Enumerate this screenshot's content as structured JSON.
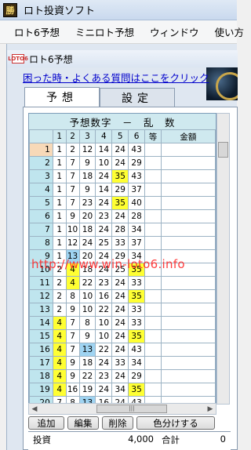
{
  "app": {
    "title": "ロト投資ソフト",
    "icon": "app-icon",
    "icon_glyph": "勝"
  },
  "menu": [
    "ロト6予想",
    "ミニロト予想",
    "ウィンドウ",
    "使い方"
  ],
  "child_window": {
    "title": "ロト6予想",
    "icon": "loto6-icon",
    "icon_text": "LOTO6"
  },
  "help_link": "困った時・よくある質問はここをクリック",
  "tabs": [
    {
      "label": "予想",
      "active": true
    },
    {
      "label": "設定",
      "active": false
    }
  ],
  "grid": {
    "banner": "予想数字　－　乱　数",
    "columns": [
      "",
      "1",
      "2",
      "3",
      "4",
      "5",
      "6",
      "等",
      "金額"
    ],
    "rows": [
      {
        "n": "1",
        "v": [
          "1",
          "2",
          "12",
          "14",
          "24",
          "43"
        ],
        "hl": [
          "",
          "",
          "",
          "",
          "",
          ""
        ],
        "current": true
      },
      {
        "n": "2",
        "v": [
          "1",
          "7",
          "9",
          "10",
          "24",
          "29"
        ],
        "hl": [
          "",
          "",
          "",
          "",
          "",
          ""
        ]
      },
      {
        "n": "3",
        "v": [
          "1",
          "7",
          "18",
          "24",
          "35",
          "43"
        ],
        "hl": [
          "",
          "",
          "",
          "",
          "y",
          ""
        ]
      },
      {
        "n": "4",
        "v": [
          "1",
          "7",
          "9",
          "14",
          "29",
          "37"
        ],
        "hl": [
          "",
          "",
          "",
          "",
          "",
          ""
        ]
      },
      {
        "n": "5",
        "v": [
          "1",
          "7",
          "23",
          "24",
          "35",
          "40"
        ],
        "hl": [
          "",
          "",
          "",
          "",
          "y",
          ""
        ]
      },
      {
        "n": "6",
        "v": [
          "1",
          "9",
          "20",
          "23",
          "24",
          "28"
        ],
        "hl": [
          "",
          "",
          "",
          "",
          "",
          ""
        ]
      },
      {
        "n": "7",
        "v": [
          "1",
          "10",
          "18",
          "24",
          "28",
          "34"
        ],
        "hl": [
          "",
          "",
          "",
          "",
          "",
          ""
        ]
      },
      {
        "n": "8",
        "v": [
          "1",
          "12",
          "24",
          "25",
          "33",
          "37"
        ],
        "hl": [
          "",
          "",
          "",
          "",
          "",
          ""
        ]
      },
      {
        "n": "9",
        "v": [
          "1",
          "13",
          "20",
          "24",
          "29",
          "34"
        ],
        "hl": [
          "",
          "b",
          "",
          "",
          "",
          ""
        ]
      },
      {
        "n": "10",
        "v": [
          "2",
          "4",
          "18",
          "24",
          "25",
          "35"
        ],
        "hl": [
          "",
          "y",
          "",
          "",
          "",
          "y"
        ]
      },
      {
        "n": "11",
        "v": [
          "2",
          "4",
          "22",
          "23",
          "24",
          "33"
        ],
        "hl": [
          "",
          "y",
          "",
          "",
          "",
          ""
        ]
      },
      {
        "n": "12",
        "v": [
          "2",
          "8",
          "10",
          "16",
          "24",
          "35"
        ],
        "hl": [
          "",
          "",
          "",
          "",
          "",
          "y"
        ]
      },
      {
        "n": "13",
        "v": [
          "2",
          "9",
          "10",
          "22",
          "24",
          "33"
        ],
        "hl": [
          "",
          "",
          "",
          "",
          "",
          ""
        ]
      },
      {
        "n": "14",
        "v": [
          "4",
          "7",
          "8",
          "10",
          "24",
          "33"
        ],
        "hl": [
          "y",
          "",
          "",
          "",
          "",
          ""
        ]
      },
      {
        "n": "15",
        "v": [
          "4",
          "7",
          "9",
          "10",
          "24",
          "35"
        ],
        "hl": [
          "y",
          "",
          "",
          "",
          "",
          "y"
        ]
      },
      {
        "n": "16",
        "v": [
          "4",
          "7",
          "13",
          "22",
          "24",
          "43"
        ],
        "hl": [
          "y",
          "",
          "b",
          "",
          "",
          ""
        ]
      },
      {
        "n": "17",
        "v": [
          "4",
          "9",
          "18",
          "24",
          "33",
          "34"
        ],
        "hl": [
          "y",
          "",
          "",
          "",
          "",
          ""
        ]
      },
      {
        "n": "18",
        "v": [
          "4",
          "9",
          "22",
          "23",
          "24",
          "29"
        ],
        "hl": [
          "y",
          "",
          "",
          "",
          "",
          ""
        ]
      },
      {
        "n": "19",
        "v": [
          "4",
          "16",
          "19",
          "24",
          "34",
          "35"
        ],
        "hl": [
          "y",
          "",
          "",
          "",
          "",
          "y"
        ]
      },
      {
        "n": "20",
        "v": [
          "7",
          "8",
          "13",
          "16",
          "24",
          "43"
        ],
        "hl": [
          "",
          "",
          "b",
          "",
          "",
          ""
        ]
      }
    ]
  },
  "watermark": "http://www.win-loto6.info",
  "buttons": [
    "追加",
    "編集",
    "削除",
    "色分けする"
  ],
  "summary": {
    "invest_label": "投資",
    "invest_value": "4,000",
    "total_label": "合計",
    "total_value": "0"
  },
  "colors": {
    "highlight_yellow": "#ffff33",
    "highlight_blue": "#9fd4f2",
    "header_cyan": "#cfe9ef",
    "link": "#0000cc"
  }
}
